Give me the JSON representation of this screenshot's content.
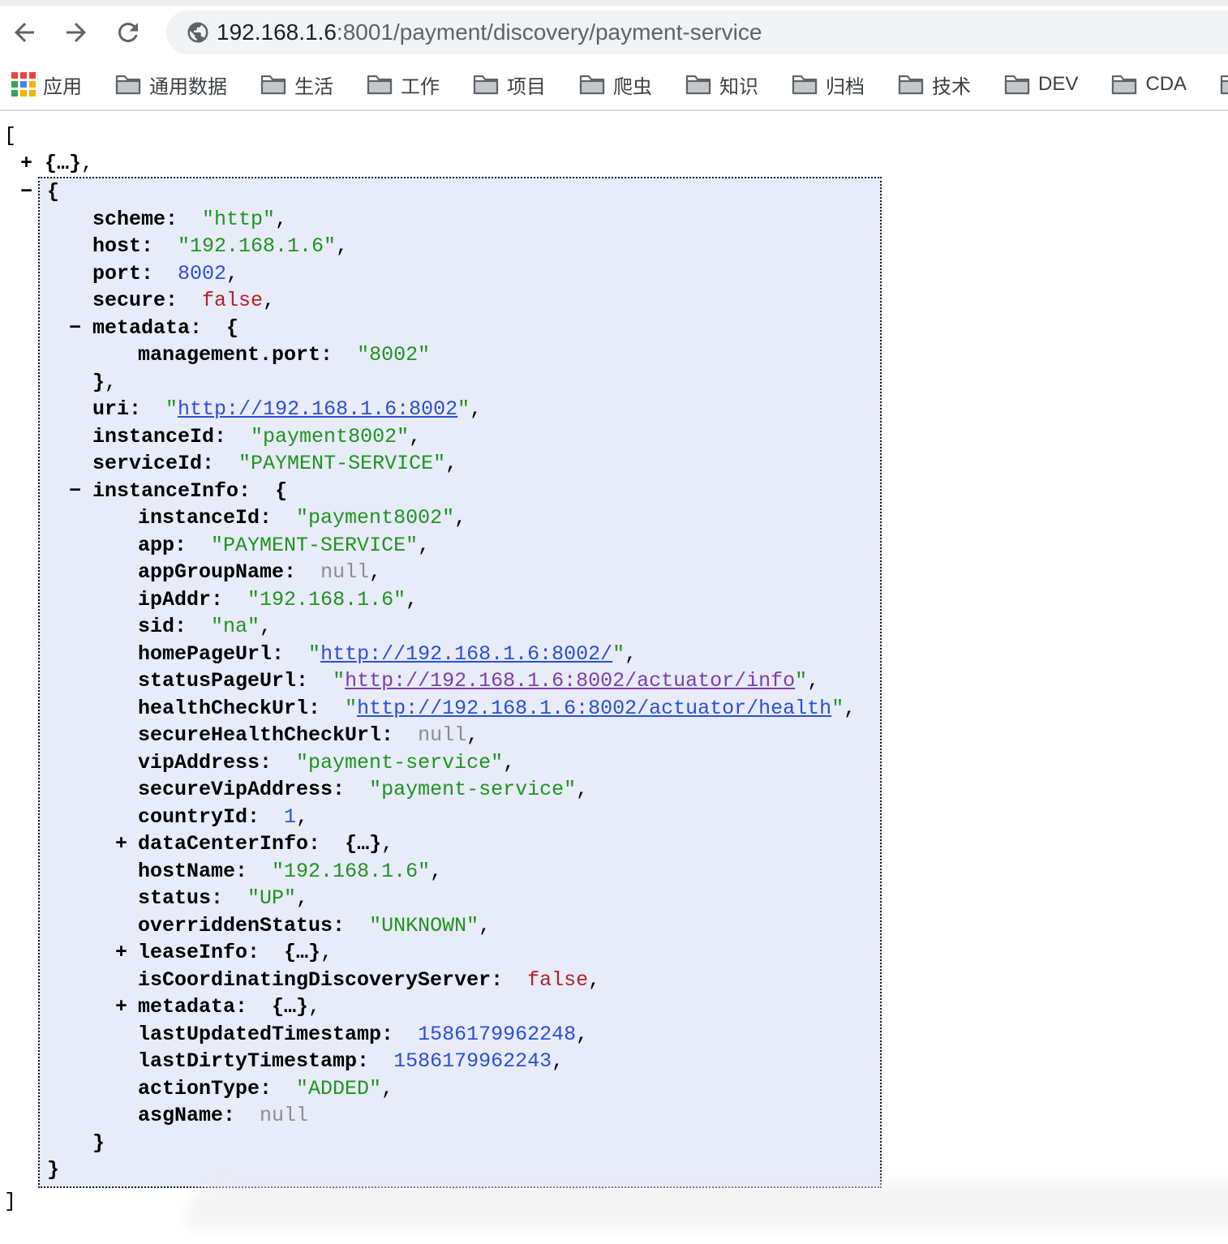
{
  "browser": {
    "toolbar": {
      "url_host": "192.168.1.6",
      "url_path": ":8001/payment/discovery/payment-service"
    },
    "bookmarks": {
      "apps_label": "应用",
      "folders": [
        "通用数据",
        "生活",
        "工作",
        "项目",
        "爬虫",
        "知识",
        "归档",
        "技术",
        "DEV",
        "CDA"
      ]
    }
  },
  "colors": {
    "json_key": "#000000",
    "json_string": "#1f941f",
    "json_number": "#2850d8",
    "json_boolean": "#b22222",
    "json_null": "#8d8d8d",
    "json_link": "#2a4fd4",
    "json_link_visited": "#7b3fa8",
    "selection_background": "#e8ebf8",
    "omnibox_background": "#f1f3f4"
  },
  "json_viewer": {
    "pre_lines": [
      {
        "in": 5,
        "seg": [
          [
            "d",
            "["
          ]
        ]
      },
      {
        "in": 55,
        "mk": "+",
        "mx": 25,
        "seg": [
          [
            "bb",
            "{…}"
          ],
          [
            "d",
            ","
          ]
        ]
      }
    ],
    "box_lines": [
      {
        "in": 9,
        "mk": "−",
        "mx": -24,
        "seg": [
          [
            "bb",
            "{"
          ]
        ]
      },
      {
        "in": 65,
        "seg": [
          [
            "p",
            "scheme:"
          ],
          [
            "d",
            "  "
          ],
          [
            "s",
            "\"http\""
          ],
          [
            "d",
            ","
          ]
        ]
      },
      {
        "in": 65,
        "seg": [
          [
            "p",
            "host:"
          ],
          [
            "d",
            "  "
          ],
          [
            "s",
            "\"192.168.1.6\""
          ],
          [
            "d",
            ","
          ]
        ]
      },
      {
        "in": 65,
        "seg": [
          [
            "p",
            "port:"
          ],
          [
            "d",
            "  "
          ],
          [
            "n",
            "8002"
          ],
          [
            "d",
            ","
          ]
        ]
      },
      {
        "in": 65,
        "seg": [
          [
            "p",
            "secure:"
          ],
          [
            "d",
            "  "
          ],
          [
            "b",
            "false"
          ],
          [
            "d",
            ","
          ]
        ]
      },
      {
        "in": 65,
        "mk": "−",
        "mx": 36,
        "seg": [
          [
            "p",
            "metadata:"
          ],
          [
            "d",
            "  "
          ],
          [
            "bb",
            "{"
          ]
        ]
      },
      {
        "in": 121,
        "seg": [
          [
            "p",
            "management.port:"
          ],
          [
            "d",
            "  "
          ],
          [
            "s",
            "\"8002\""
          ]
        ]
      },
      {
        "in": 65,
        "seg": [
          [
            "bb",
            "}"
          ],
          [
            "d",
            ","
          ]
        ]
      },
      {
        "in": 65,
        "seg": [
          [
            "p",
            "uri:"
          ],
          [
            "d",
            "  "
          ],
          [
            "s",
            "\""
          ],
          [
            "l",
            "http://192.168.1.6:8002"
          ],
          [
            "s",
            "\""
          ],
          [
            "d",
            ","
          ]
        ]
      },
      {
        "in": 65,
        "seg": [
          [
            "p",
            "instanceId:"
          ],
          [
            "d",
            "  "
          ],
          [
            "s",
            "\"payment8002\""
          ],
          [
            "d",
            ","
          ]
        ]
      },
      {
        "in": 65,
        "seg": [
          [
            "p",
            "serviceId:"
          ],
          [
            "d",
            "  "
          ],
          [
            "s",
            "\"PAYMENT-SERVICE\""
          ],
          [
            "d",
            ","
          ]
        ]
      },
      {
        "in": 65,
        "mk": "−",
        "mx": 36,
        "seg": [
          [
            "p",
            "instanceInfo:"
          ],
          [
            "d",
            "  "
          ],
          [
            "bb",
            "{"
          ]
        ]
      },
      {
        "in": 121,
        "seg": [
          [
            "p",
            "instanceId:"
          ],
          [
            "d",
            "  "
          ],
          [
            "s",
            "\"payment8002\""
          ],
          [
            "d",
            ","
          ]
        ]
      },
      {
        "in": 121,
        "seg": [
          [
            "p",
            "app:"
          ],
          [
            "d",
            "  "
          ],
          [
            "s",
            "\"PAYMENT-SERVICE\""
          ],
          [
            "d",
            ","
          ]
        ]
      },
      {
        "in": 121,
        "seg": [
          [
            "p",
            "appGroupName:"
          ],
          [
            "d",
            "  "
          ],
          [
            "u",
            "null"
          ],
          [
            "d",
            ","
          ]
        ]
      },
      {
        "in": 121,
        "seg": [
          [
            "p",
            "ipAddr:"
          ],
          [
            "d",
            "  "
          ],
          [
            "s",
            "\"192.168.1.6\""
          ],
          [
            "d",
            ","
          ]
        ]
      },
      {
        "in": 121,
        "seg": [
          [
            "p",
            "sid:"
          ],
          [
            "d",
            "  "
          ],
          [
            "s",
            "\"na\""
          ],
          [
            "d",
            ","
          ]
        ]
      },
      {
        "in": 121,
        "seg": [
          [
            "p",
            "homePageUrl:"
          ],
          [
            "d",
            "  "
          ],
          [
            "s",
            "\""
          ],
          [
            "l",
            "http://192.168.1.6:8002/"
          ],
          [
            "s",
            "\""
          ],
          [
            "d",
            ","
          ]
        ]
      },
      {
        "in": 121,
        "seg": [
          [
            "p",
            "statusPageUrl:"
          ],
          [
            "d",
            "  "
          ],
          [
            "s",
            "\""
          ],
          [
            "v",
            "http://192.168.1.6:8002/actuator/info"
          ],
          [
            "s",
            "\""
          ],
          [
            "d",
            ","
          ]
        ]
      },
      {
        "in": 121,
        "seg": [
          [
            "p",
            "healthCheckUrl:"
          ],
          [
            "d",
            "  "
          ],
          [
            "s",
            "\""
          ],
          [
            "l",
            "http://192.168.1.6:8002/actuator/health"
          ],
          [
            "s",
            "\""
          ],
          [
            "d",
            ","
          ]
        ]
      },
      {
        "in": 121,
        "seg": [
          [
            "p",
            "secureHealthCheckUrl:"
          ],
          [
            "d",
            "  "
          ],
          [
            "u",
            "null"
          ],
          [
            "d",
            ","
          ]
        ]
      },
      {
        "in": 121,
        "seg": [
          [
            "p",
            "vipAddress:"
          ],
          [
            "d",
            "  "
          ],
          [
            "s",
            "\"payment-service\""
          ],
          [
            "d",
            ","
          ]
        ]
      },
      {
        "in": 121,
        "seg": [
          [
            "p",
            "secureVipAddress:"
          ],
          [
            "d",
            "  "
          ],
          [
            "s",
            "\"payment-service\""
          ],
          [
            "d",
            ","
          ]
        ]
      },
      {
        "in": 121,
        "seg": [
          [
            "p",
            "countryId:"
          ],
          [
            "d",
            "  "
          ],
          [
            "n",
            "1"
          ],
          [
            "d",
            ","
          ]
        ]
      },
      {
        "in": 121,
        "mk": "+",
        "mx": 93,
        "seg": [
          [
            "p",
            "dataCenterInfo:"
          ],
          [
            "d",
            "  "
          ],
          [
            "bb",
            "{…}"
          ],
          [
            "d",
            ","
          ]
        ]
      },
      {
        "in": 121,
        "seg": [
          [
            "p",
            "hostName:"
          ],
          [
            "d",
            "  "
          ],
          [
            "s",
            "\"192.168.1.6\""
          ],
          [
            "d",
            ","
          ]
        ]
      },
      {
        "in": 121,
        "seg": [
          [
            "p",
            "status:"
          ],
          [
            "d",
            "  "
          ],
          [
            "s",
            "\"UP\""
          ],
          [
            "d",
            ","
          ]
        ]
      },
      {
        "in": 121,
        "seg": [
          [
            "p",
            "overriddenStatus:"
          ],
          [
            "d",
            "  "
          ],
          [
            "s",
            "\"UNKNOWN\""
          ],
          [
            "d",
            ","
          ]
        ]
      },
      {
        "in": 121,
        "mk": "+",
        "mx": 93,
        "seg": [
          [
            "p",
            "leaseInfo:"
          ],
          [
            "d",
            "  "
          ],
          [
            "bb",
            "{…}"
          ],
          [
            "d",
            ","
          ]
        ]
      },
      {
        "in": 121,
        "seg": [
          [
            "p",
            "isCoordinatingDiscoveryServer:"
          ],
          [
            "d",
            "  "
          ],
          [
            "b",
            "false"
          ],
          [
            "d",
            ","
          ]
        ]
      },
      {
        "in": 121,
        "mk": "+",
        "mx": 93,
        "seg": [
          [
            "p",
            "metadata:"
          ],
          [
            "d",
            "  "
          ],
          [
            "bb",
            "{…}"
          ],
          [
            "d",
            ","
          ]
        ]
      },
      {
        "in": 121,
        "seg": [
          [
            "p",
            "lastUpdatedTimestamp:"
          ],
          [
            "d",
            "  "
          ],
          [
            "n",
            "1586179962248"
          ],
          [
            "d",
            ","
          ]
        ]
      },
      {
        "in": 121,
        "seg": [
          [
            "p",
            "lastDirtyTimestamp:"
          ],
          [
            "d",
            "  "
          ],
          [
            "n",
            "1586179962243"
          ],
          [
            "d",
            ","
          ]
        ]
      },
      {
        "in": 121,
        "seg": [
          [
            "p",
            "actionType:"
          ],
          [
            "d",
            "  "
          ],
          [
            "s",
            "\"ADDED\""
          ],
          [
            "d",
            ","
          ]
        ]
      },
      {
        "in": 121,
        "seg": [
          [
            "p",
            "asgName:"
          ],
          [
            "d",
            "  "
          ],
          [
            "u",
            "null"
          ]
        ]
      },
      {
        "in": 65,
        "seg": [
          [
            "bb",
            "}"
          ]
        ]
      },
      {
        "in": 9,
        "seg": [
          [
            "bb",
            "}"
          ]
        ]
      }
    ],
    "post_lines": [
      {
        "in": 5,
        "seg": [
          [
            "d",
            "]"
          ]
        ]
      }
    ]
  }
}
